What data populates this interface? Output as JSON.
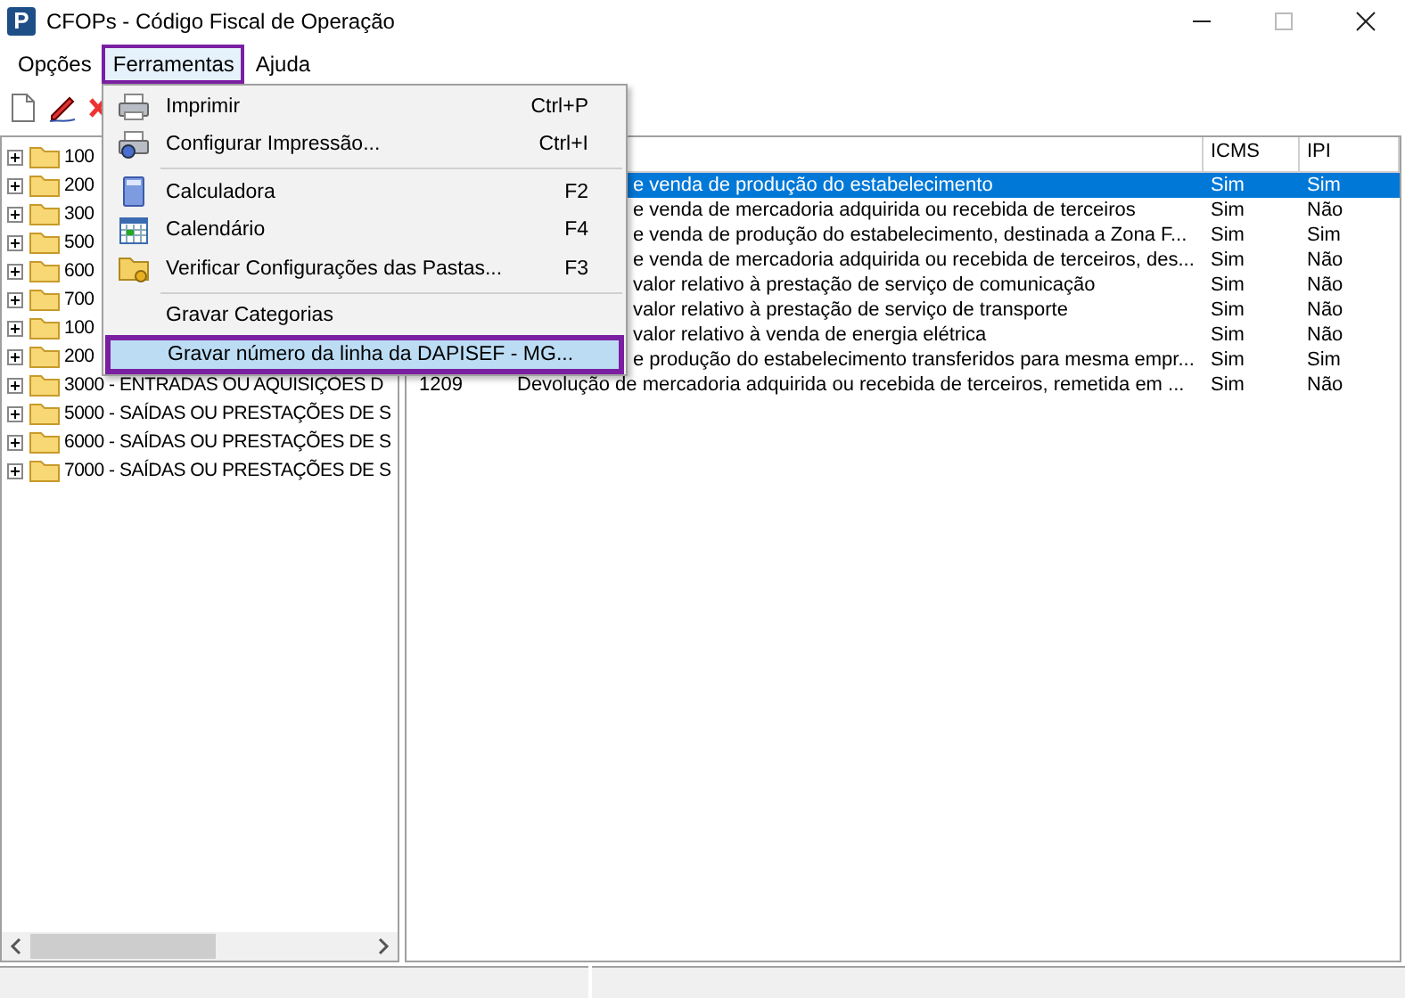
{
  "window": {
    "title": "CFOPs - Código Fiscal de Operação",
    "logo": "P",
    "maximize_disabled": true
  },
  "menu_bar": [
    {
      "label": "Opções",
      "selected": false
    },
    {
      "label": "Ferramentas",
      "selected": true
    },
    {
      "label": "Ajuda",
      "selected": false
    }
  ],
  "dropdown": {
    "items": [
      {
        "kind": "item",
        "label": "Imprimir",
        "shortcut": "Ctrl+P",
        "selected": false
      },
      {
        "kind": "item",
        "label": "Configurar Impressão...",
        "shortcut": "Ctrl+I",
        "selected": false
      },
      {
        "kind": "separator"
      },
      {
        "kind": "item",
        "label": "Calculadora",
        "shortcut": "F2",
        "selected": false
      },
      {
        "kind": "item",
        "label": "Calendário",
        "shortcut": "F4",
        "selected": false
      },
      {
        "kind": "item",
        "label": "Verificar Configurações das Pastas...",
        "shortcut": "F3",
        "selected": false
      },
      {
        "kind": "separator"
      },
      {
        "kind": "item",
        "label": "Gravar Categorias",
        "selected": false
      },
      {
        "kind": "item",
        "label": "Gravar número da linha da DAPISEF - MG...",
        "selected": true
      }
    ]
  },
  "tree": {
    "items": [
      {
        "label": "100",
        "expanded": false
      },
      {
        "label": "200",
        "expanded": false
      },
      {
        "label": "300",
        "expanded": false
      },
      {
        "label": "500",
        "expanded": false
      },
      {
        "label": "600",
        "expanded": false
      },
      {
        "label": "700",
        "expanded": false
      },
      {
        "label": "100",
        "expanded": false
      },
      {
        "label": "200",
        "expanded": false
      },
      {
        "label": "3000 - ENTRADAS OU AQUISIÇÕES D",
        "expanded": false
      },
      {
        "label": "5000 - SAÍDAS OU PRESTAÇÕES DE S",
        "expanded": false
      },
      {
        "label": "6000 - SAÍDAS OU PRESTAÇÕES DE S",
        "expanded": false
      },
      {
        "label": "7000 - SAÍDAS OU PRESTAÇÕES DE S",
        "expanded": false
      }
    ]
  },
  "table": {
    "columns": [
      "ICMS",
      "IPI"
    ],
    "rows": [
      {
        "description": "e venda de produção do estabelecimento",
        "icms": "Sim",
        "ipi": "Sim",
        "selected": true
      },
      {
        "description": "e venda de mercadoria adquirida ou recebida de terceiros",
        "icms": "Sim",
        "ipi": "Não",
        "selected": false
      },
      {
        "description": "e venda de produção do estabelecimento, destinada a Zona F...",
        "icms": "Sim",
        "ipi": "Sim",
        "selected": false
      },
      {
        "description": "e venda de mercadoria adquirida ou recebida de terceiros, des...",
        "icms": "Sim",
        "ipi": "Não",
        "selected": false
      },
      {
        "description": "valor relativo à prestação de serviço de comunicação",
        "icms": "Sim",
        "ipi": "Não",
        "selected": false
      },
      {
        "description": "valor relativo à prestação de serviço de transporte",
        "icms": "Sim",
        "ipi": "Não",
        "selected": false
      },
      {
        "description": "valor relativo à venda de energia elétrica",
        "icms": "Sim",
        "ipi": "Não",
        "selected": false
      },
      {
        "description": "e produção do estabelecimento transferidos para mesma empr...",
        "icms": "Sim",
        "ipi": "Sim",
        "selected": false
      },
      {
        "code": "1209",
        "description": "Devolução de mercadoria adquirida ou recebida de terceiros, remetida em ...",
        "icms": "Sim",
        "ipi": "Não",
        "selected": false
      }
    ]
  }
}
